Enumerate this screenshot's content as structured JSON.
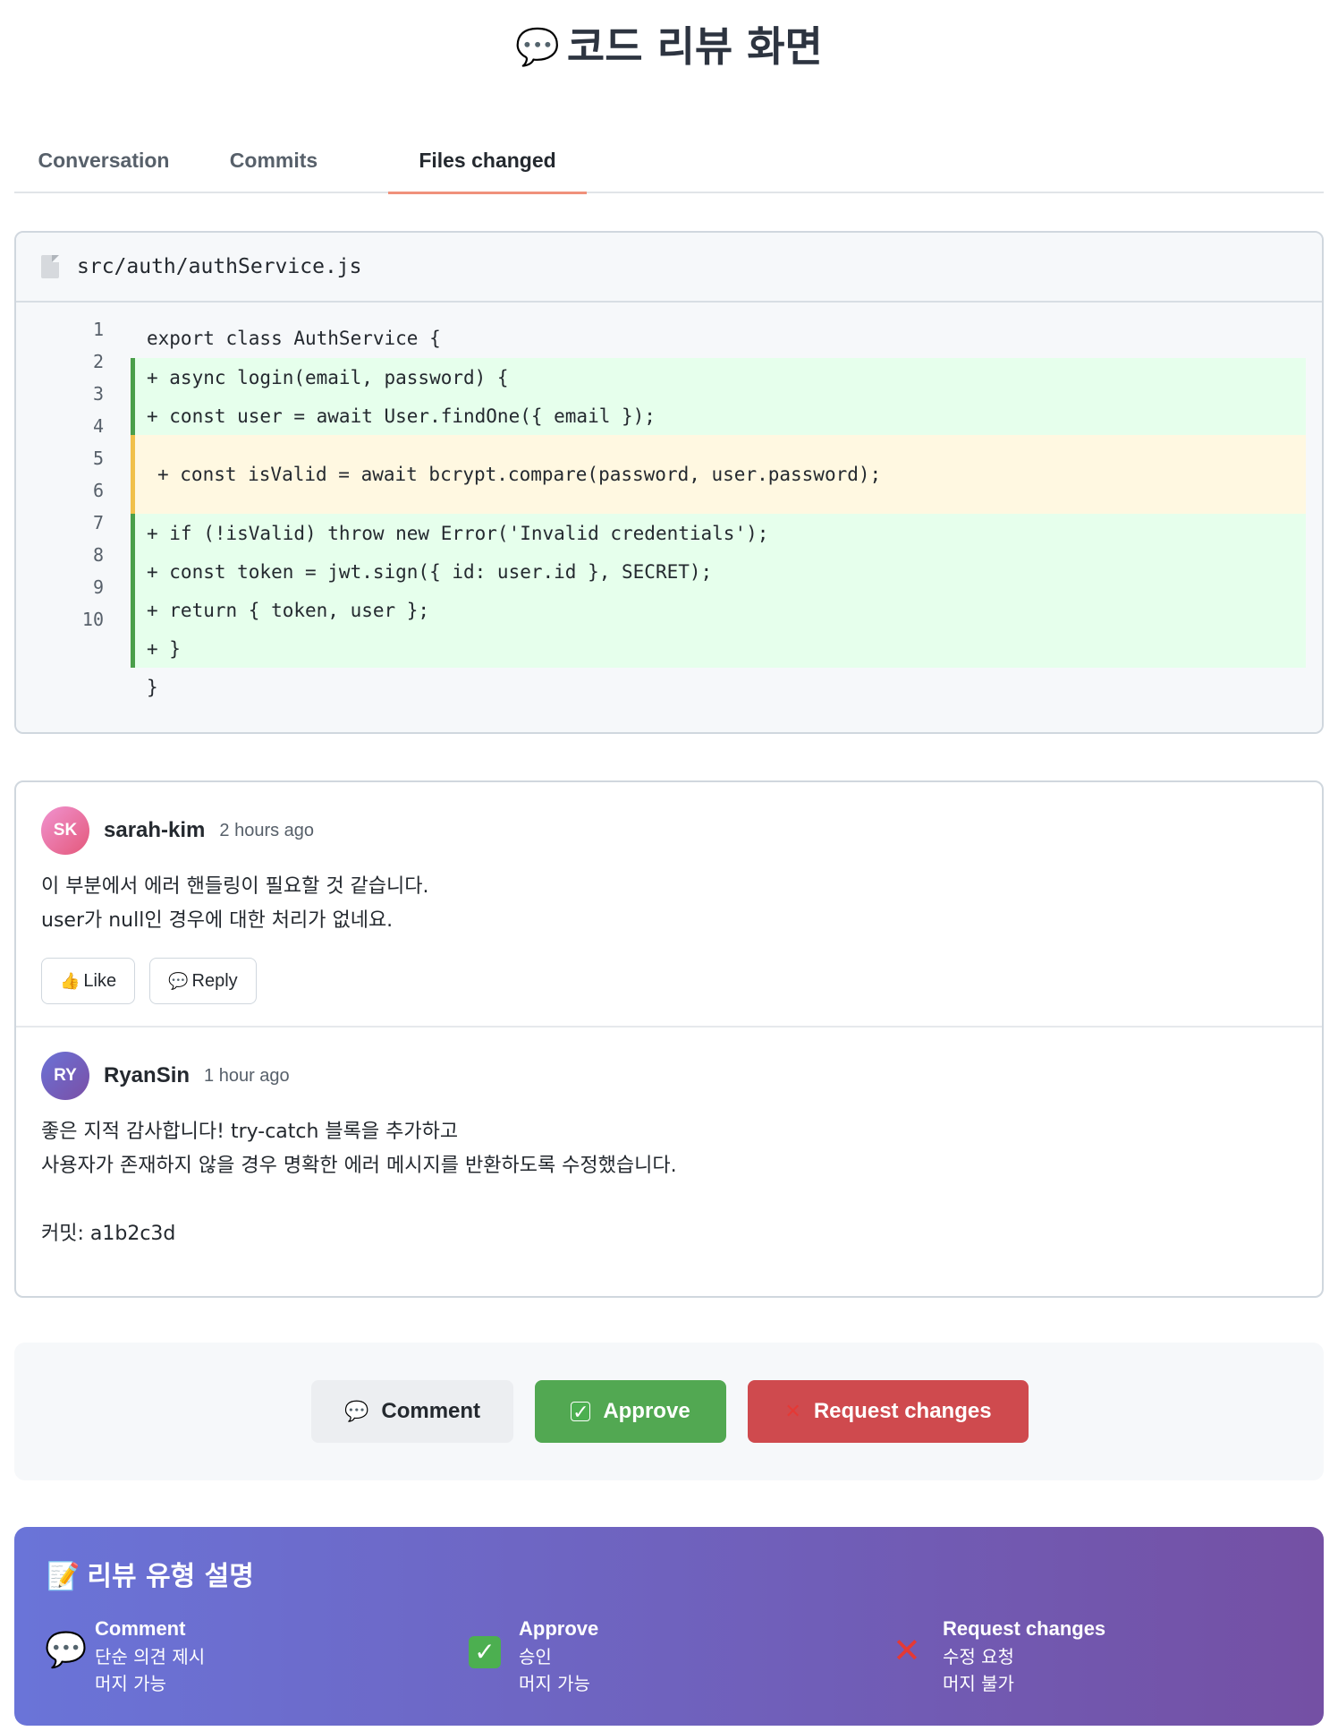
{
  "header": {
    "title": "코드 리뷰 화면",
    "title_icon": "speech-balloon-icon"
  },
  "tabs": [
    {
      "label": "Conversation",
      "active": false
    },
    {
      "label": "Commits",
      "active": false
    },
    {
      "label": "Files changed",
      "active": true
    }
  ],
  "file": {
    "path": "src/auth/authService.js",
    "line_numbers": [
      "1",
      "2",
      "3",
      "4",
      "5",
      "6",
      "7",
      "8",
      "9",
      "10"
    ],
    "lines": [
      {
        "text": "export class AuthService {",
        "type": "plain"
      },
      {
        "text": "+ async login(email, password) {",
        "type": "added"
      },
      {
        "text": "+ const user = await User.findOne({ email });",
        "type": "added"
      },
      {
        "text": "+ const isValid = await bcrypt.compare(password, user.password);",
        "type": "highlighted"
      },
      {
        "text": "+ if (!isValid) throw new Error('Invalid credentials');",
        "type": "added"
      },
      {
        "text": "+ const token = jwt.sign({ id: user.id }, SECRET);",
        "type": "added"
      },
      {
        "text": "+ return { token, user };",
        "type": "added"
      },
      {
        "text": "+ }",
        "type": "added"
      },
      {
        "text": "}",
        "type": "plain"
      }
    ]
  },
  "comments": [
    {
      "initials": "SK",
      "user": "sarah-kim",
      "time": "2 hours ago",
      "body_line1": "이 부분에서 에러 핸들링이 필요할 것 같습니다.",
      "body_line2": "user가 null인 경우에 대한 처리가 없네요.",
      "like_label": "Like",
      "reply_label": "Reply"
    },
    {
      "initials": "RY",
      "user": "RyanSin",
      "time": "1 hour ago",
      "body_line1": "좋은 지적 감사합니다! try-catch 블록을 추가하고",
      "body_line2": "사용자가 존재하지 않을 경우 명확한 에러 메시지를 반환하도록 수정했습니다.",
      "commit_line": "커밋: a1b2c3d"
    }
  ],
  "actions": {
    "comment_label": "Comment",
    "approve_label": "Approve",
    "request_label": "Request changes"
  },
  "legend": {
    "title": "리뷰 유형 설명",
    "items": [
      {
        "name": "Comment",
        "desc1": "단순 의견 제시",
        "desc2": "머지 가능",
        "icon": "speech-balloon-icon"
      },
      {
        "name": "Approve",
        "desc1": "승인",
        "desc2": "머지 가능",
        "icon": "check-mark-icon"
      },
      {
        "name": "Request changes",
        "desc1": "수정 요청",
        "desc2": "머지 불가",
        "icon": "cross-mark-icon"
      }
    ]
  },
  "colors": {
    "added_bg": "#e6ffec",
    "added_border": "#4a9f4a",
    "highlight_bg": "#fff8e1",
    "highlight_border": "#f0c04a",
    "approve": "#52a852",
    "request_changes": "#cf4a4e",
    "active_tab_underline": "#f0917b"
  }
}
